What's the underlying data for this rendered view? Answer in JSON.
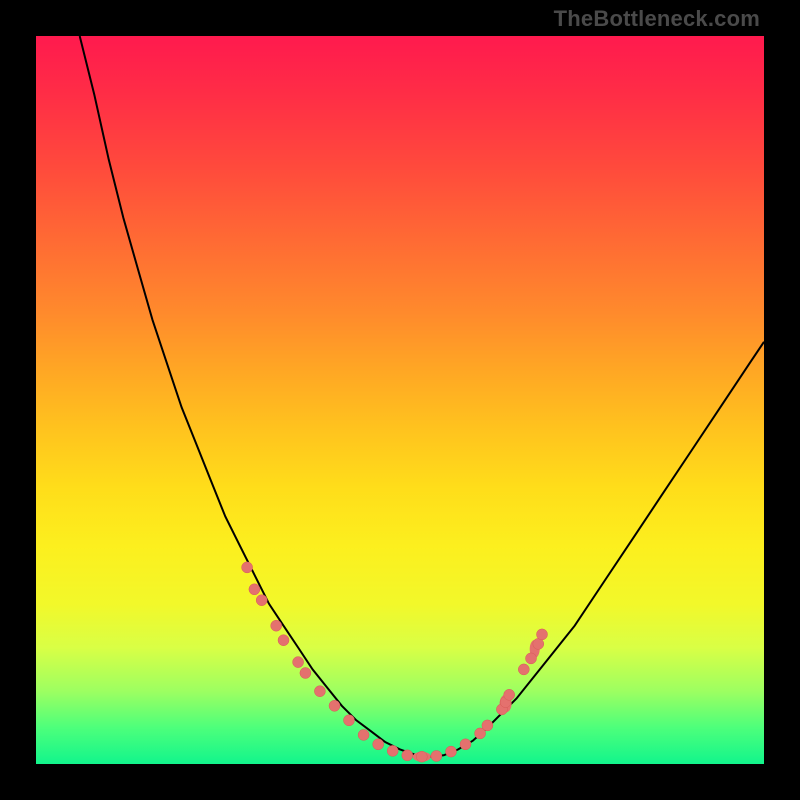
{
  "watermark": "TheBottleneck.com",
  "colors": {
    "frame_bg": "#000000",
    "gradient_top": "#ff1a4e",
    "gradient_bottom": "#12f58c",
    "curve": "#000000",
    "markers": "#e4716e"
  },
  "chart_data": {
    "type": "line",
    "title": "",
    "xlabel": "",
    "ylabel": "",
    "xlim": [
      0,
      100
    ],
    "ylim": [
      0,
      100
    ],
    "grid": false,
    "legend": false,
    "x": [
      6,
      8,
      10,
      12,
      14,
      16,
      18,
      20,
      22,
      24,
      26,
      28,
      30,
      32,
      34,
      36,
      38,
      40,
      42,
      44,
      46,
      48,
      50,
      52,
      54,
      56,
      58,
      60,
      62,
      66,
      70,
      74,
      78,
      82,
      86,
      90,
      94,
      98,
      100
    ],
    "values": [
      100,
      92,
      83,
      75,
      68,
      61,
      55,
      49,
      44,
      39,
      34,
      30,
      26,
      22,
      19,
      16,
      13,
      10.5,
      8,
      6,
      4.5,
      3,
      2,
      1.3,
      1,
      1.2,
      2,
      3.2,
      5,
      9,
      14,
      19,
      25,
      31,
      37,
      43,
      49,
      55,
      58
    ],
    "series": [
      {
        "name": "bottleneck-curve",
        "x_ref": "x",
        "y_ref": "values"
      }
    ],
    "markers": {
      "name": "highlight-points",
      "points": [
        {
          "x": 29,
          "y": 27
        },
        {
          "x": 30,
          "y": 24
        },
        {
          "x": 31,
          "y": 22.5
        },
        {
          "x": 33,
          "y": 19
        },
        {
          "x": 34,
          "y": 17
        },
        {
          "x": 36,
          "y": 14
        },
        {
          "x": 37,
          "y": 12.5
        },
        {
          "x": 39,
          "y": 10
        },
        {
          "x": 41,
          "y": 8
        },
        {
          "x": 43,
          "y": 6
        },
        {
          "x": 45,
          "y": 4
        },
        {
          "x": 47,
          "y": 2.7
        },
        {
          "x": 49,
          "y": 1.8
        },
        {
          "x": 51,
          "y": 1.2
        },
        {
          "x": 53,
          "y": 1
        },
        {
          "x": 55,
          "y": 1.1
        },
        {
          "x": 57,
          "y": 1.7
        },
        {
          "x": 59,
          "y": 2.7
        },
        {
          "x": 61,
          "y": 4.2
        },
        {
          "x": 62,
          "y": 5.3
        },
        {
          "x": 64,
          "y": 7.5
        },
        {
          "x": 64.5,
          "y": 8.5
        },
        {
          "x": 65,
          "y": 9.5
        },
        {
          "x": 67,
          "y": 13
        },
        {
          "x": 68,
          "y": 14.5
        },
        {
          "x": 69,
          "y": 16.5
        },
        {
          "x": 69.5,
          "y": 17.8
        }
      ]
    }
  }
}
